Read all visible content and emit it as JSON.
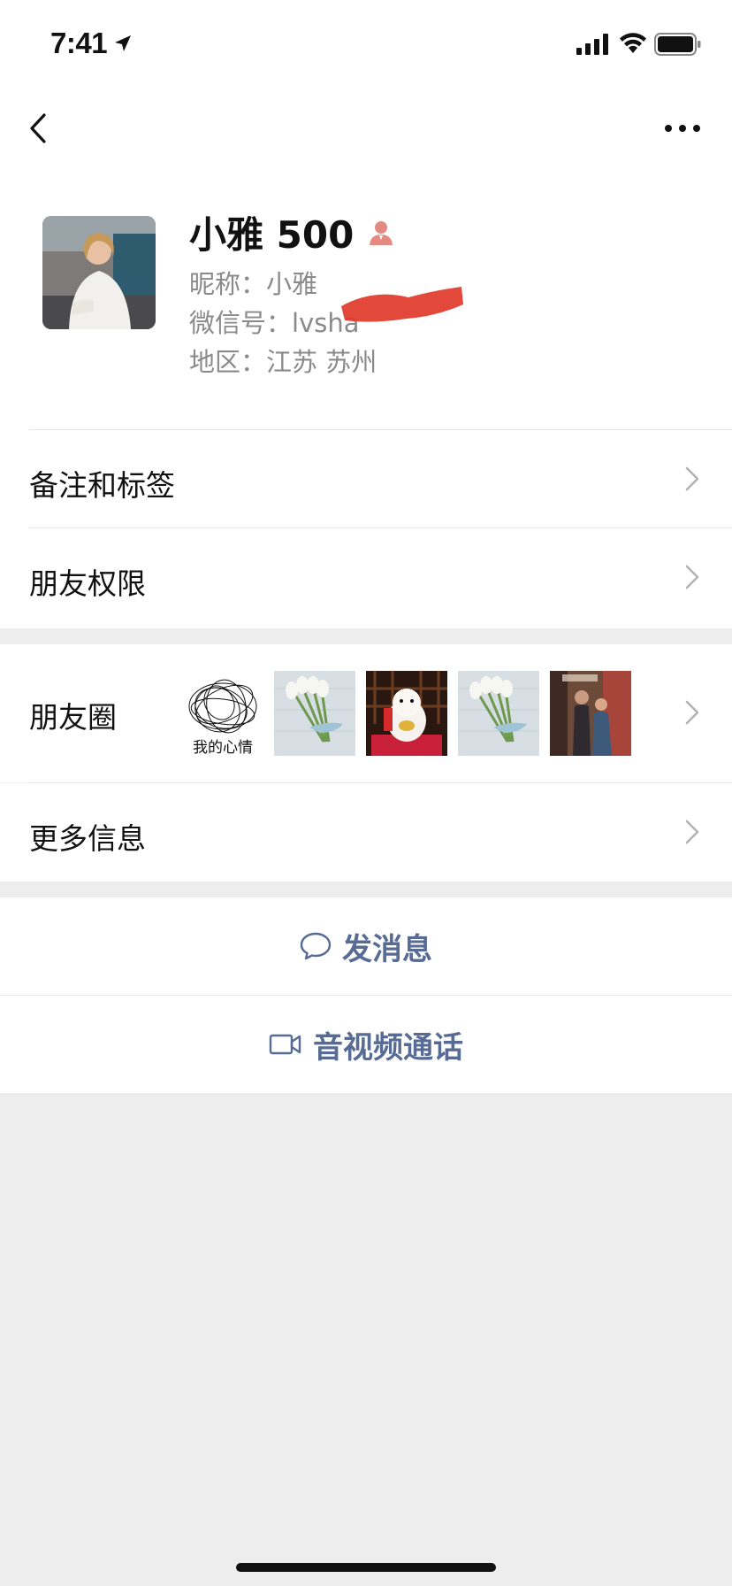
{
  "status_bar": {
    "time": "7:41"
  },
  "nav": {
    "back_icon": "chevron-left-icon",
    "more_icon": "ellipsis-icon"
  },
  "profile": {
    "name": "小雅 500",
    "nickname_label": "昵称：",
    "nickname": "小雅",
    "wechat_id_label": "微信号：",
    "wechat_id": "lvsha",
    "region_label": "地区：",
    "region": "江苏 苏州"
  },
  "rows": {
    "remarks_tags": "备注和标签",
    "friend_permissions": "朋友权限",
    "moments": "朋友圈",
    "more_info": "更多信息"
  },
  "moments_thumbs": {
    "first_caption": "我的心情"
  },
  "actions": {
    "send_message": "发消息",
    "av_call": "音视频通话"
  },
  "colors": {
    "link_blue": "#576b95",
    "background": "#ededed",
    "person_icon": "#e58a82",
    "redaction": "#e03a2a"
  }
}
